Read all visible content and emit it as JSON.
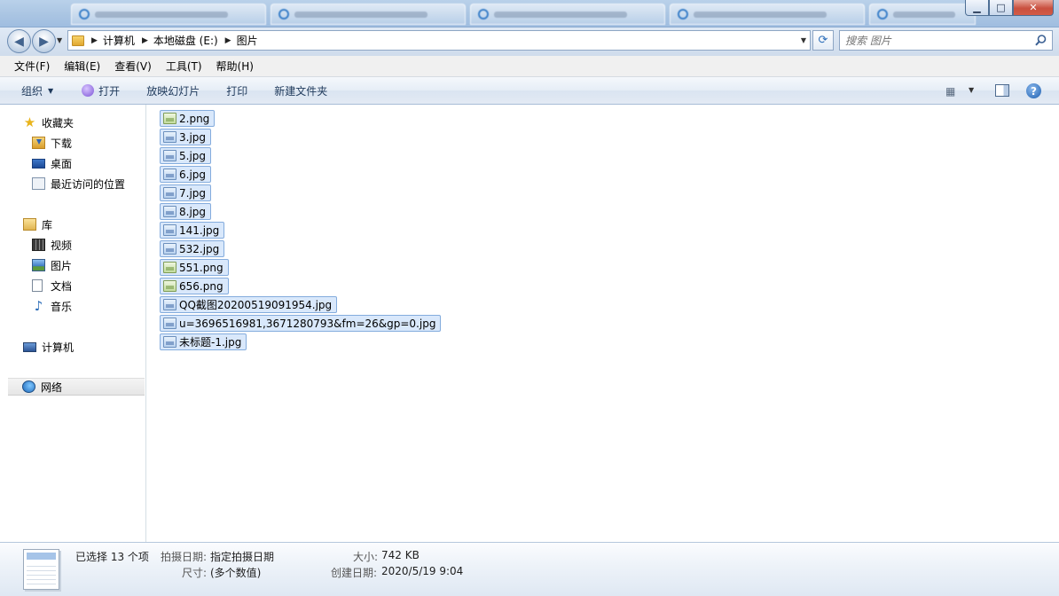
{
  "window": {
    "minimize_label": "▭",
    "maximize_label": "□",
    "close_label": "✕"
  },
  "address": {
    "breadcrumbs": [
      "计算机",
      "本地磁盘 (E:)",
      "图片"
    ],
    "search_placeholder": "搜索 图片"
  },
  "menu": {
    "items": [
      "文件(F)",
      "编辑(E)",
      "查看(V)",
      "工具(T)",
      "帮助(H)"
    ]
  },
  "toolbar": {
    "organize": "组织",
    "open": "打开",
    "slideshow": "放映幻灯片",
    "print": "打印",
    "new_folder": "新建文件夹",
    "help_glyph": "?"
  },
  "nav": {
    "favorites": "收藏夹",
    "downloads": "下载",
    "desktop": "桌面",
    "recent": "最近访问的位置",
    "libraries": "库",
    "videos": "视频",
    "pictures": "图片",
    "documents": "文档",
    "music": "音乐",
    "computer": "计算机",
    "network": "网络"
  },
  "files": [
    {
      "name": "2.png",
      "type": "png"
    },
    {
      "name": "3.jpg",
      "type": "jpg"
    },
    {
      "name": "5.jpg",
      "type": "jpg"
    },
    {
      "name": "6.jpg",
      "type": "jpg"
    },
    {
      "name": "7.jpg",
      "type": "jpg"
    },
    {
      "name": "8.jpg",
      "type": "jpg"
    },
    {
      "name": "141.jpg",
      "type": "jpg"
    },
    {
      "name": "532.jpg",
      "type": "jpg"
    },
    {
      "name": "551.png",
      "type": "png"
    },
    {
      "name": "656.png",
      "type": "png"
    },
    {
      "name": "QQ截图20200519091954.jpg",
      "type": "jpg"
    },
    {
      "name": "u=3696516981,3671280793&fm=26&gp=0.jpg",
      "type": "jpg"
    },
    {
      "name": "未标题-1.jpg",
      "type": "jpg"
    }
  ],
  "details": {
    "selection": "已选择 13 个项",
    "date_taken_label": "拍摄日期:",
    "date_taken_value": "指定拍摄日期",
    "dimensions_label": "尺寸:",
    "dimensions_value": "(多个数值)",
    "size_label": "大小:",
    "size_value": "742 KB",
    "created_label": "创建日期:",
    "created_value": "2020/5/19 9:04"
  }
}
